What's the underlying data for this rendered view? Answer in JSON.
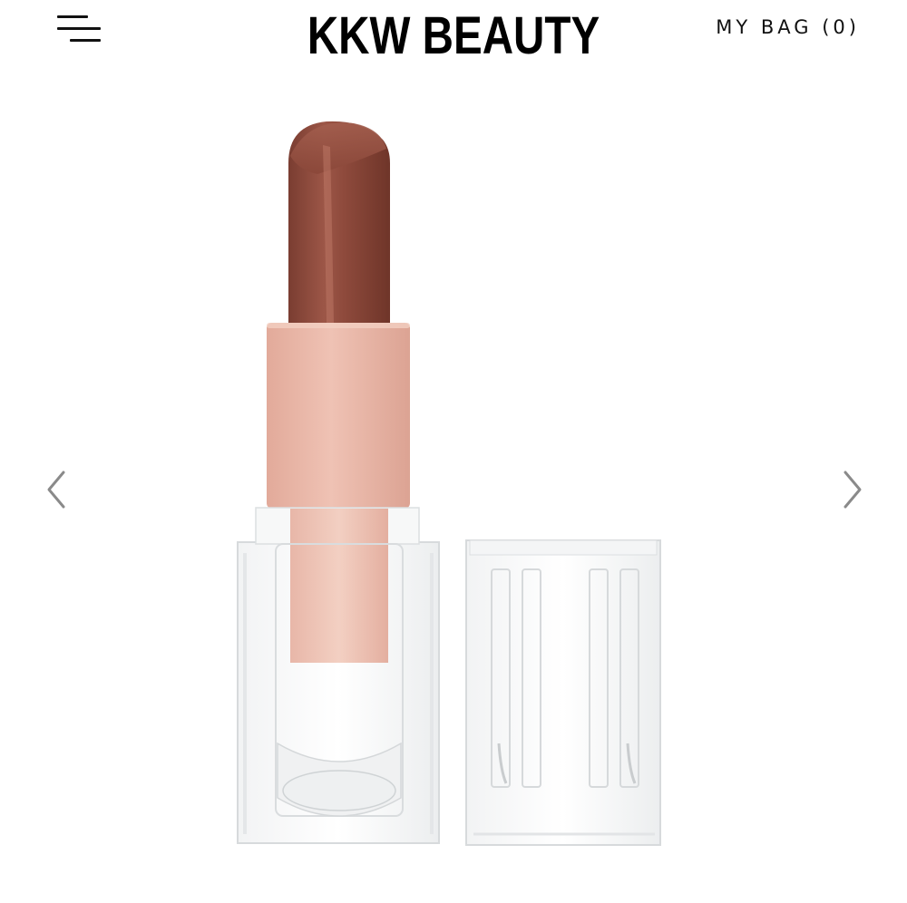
{
  "header": {
    "brand": "KKW BEAUTY",
    "bag_label": "MY BAG (0)",
    "menu_icon": "hamburger-menu-icon"
  },
  "carousel": {
    "prev_icon": "chevron-left-icon",
    "next_icon": "chevron-right-icon",
    "image_alt": "lipstick"
  },
  "colors": {
    "bullet": "#8e4a3c",
    "sleeve": "#e8b6a8",
    "text": "#111111"
  }
}
